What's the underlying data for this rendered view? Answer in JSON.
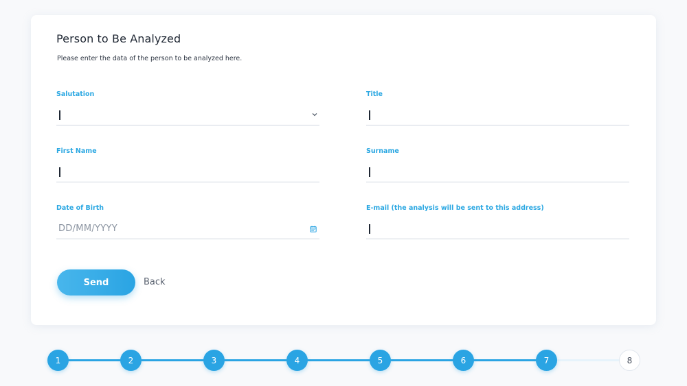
{
  "form": {
    "title": "Person to Be Analyzed",
    "subtitle": "Please enter the data of the person to be analyzed here.",
    "fields": {
      "salutation": {
        "label": "Salutation",
        "value": "",
        "icon": "chevron-down-icon"
      },
      "title": {
        "label": "Title",
        "value": ""
      },
      "first_name": {
        "label": "First Name",
        "value": ""
      },
      "surname": {
        "label": "Surname",
        "value": ""
      },
      "date_of_birth": {
        "label": "Date of Birth",
        "placeholder": "DD/MM/YYYY",
        "icon": "calendar-icon"
      },
      "email": {
        "label": "E-mail (the analysis will be sent to this address)",
        "value": ""
      }
    },
    "send_label": "Send",
    "back_label": "Back"
  },
  "stepper": {
    "steps": [
      "1",
      "2",
      "3",
      "4",
      "5",
      "6",
      "7",
      "8"
    ],
    "completed_through": 7,
    "accent_color": "#2aa4e3"
  },
  "colors": {
    "accent": "#2aa4e3",
    "label": "#2aa7e2",
    "background": "#f8f9fb",
    "card": "#ffffff"
  }
}
